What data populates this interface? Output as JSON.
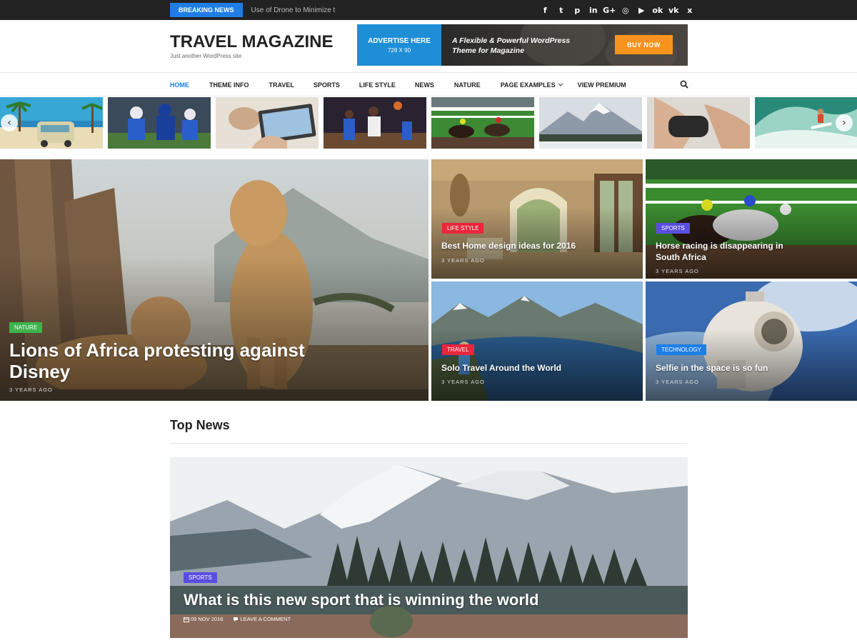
{
  "topbar": {
    "breaking_label": "BREAKING NEWS",
    "breaking_text": "Use of Drone to Minimize the",
    "socials": [
      {
        "icon": "facebook-icon",
        "glyph": "f"
      },
      {
        "icon": "twitter-icon",
        "glyph": "t"
      },
      {
        "icon": "pinterest-icon",
        "glyph": "p"
      },
      {
        "icon": "linkedin-icon",
        "glyph": "in"
      },
      {
        "icon": "google-plus-icon",
        "glyph": "G+"
      },
      {
        "icon": "instagram-icon",
        "glyph": "◎"
      },
      {
        "icon": "youtube-icon",
        "glyph": "▶"
      },
      {
        "icon": "odnoklassniki-icon",
        "glyph": "ok"
      },
      {
        "icon": "vk-icon",
        "glyph": "vk"
      },
      {
        "icon": "xing-icon",
        "glyph": "x"
      }
    ]
  },
  "header": {
    "site_title": "TRAVEL MAGAZINE",
    "tagline": "Just another WordPress site",
    "ad": {
      "left_line1": "ADVERTISE HERE",
      "left_line2": "728 X 90",
      "tag_line1": "A Flexible & Powerful WordPress",
      "tag_line2": "Theme for Magazine",
      "buy_label": "BUY NOW"
    }
  },
  "nav": {
    "items": [
      {
        "label": "HOME",
        "active": true
      },
      {
        "label": "THEME INFO"
      },
      {
        "label": "TRAVEL"
      },
      {
        "label": "SPORTS"
      },
      {
        "label": "LIFE STYLE"
      },
      {
        "label": "NEWS"
      },
      {
        "label": "NATURE"
      },
      {
        "label": "PAGE EXAMPLES"
      },
      {
        "label": "VIEW PREMIUM"
      }
    ],
    "dropdown_icon": "chevron-down-icon",
    "search_icon": "search-icon"
  },
  "featured": {
    "main": {
      "category": "NATURE",
      "title_line1": "Lions of Africa protesting against",
      "title_line2": "Disney",
      "ago": "3 YEARS AGO"
    },
    "tiles": [
      {
        "category": "LIFE STYLE",
        "title": "Best Home design ideas for 2016",
        "ago": "3 YEARS AGO"
      },
      {
        "category": "SPORTS",
        "title_line1": "Horse racing is disappearing in",
        "title_line2": "South Africa",
        "ago": "3 YEARS AGO"
      },
      {
        "category": "TRAVEL",
        "title": "Solo Travel Around the World",
        "ago": "3 YEARS AGO"
      },
      {
        "category": "TECHNOLOGY",
        "title": "Selfie in the space is so fun",
        "ago": "3 YEARS AGO"
      }
    ]
  },
  "top_news": {
    "section_title": "Top News",
    "post": {
      "category": "SPORTS",
      "title": "What is this new sport that is winning the world",
      "date": "09 NOV 2016",
      "comments": "LEAVE A COMMENT"
    }
  },
  "colors": {
    "accent_blue": "#1e7ee6",
    "life_style": "#e8273b",
    "sports": "#5a4ee0",
    "travel": "#e8273b",
    "technology": "#1e7ee6",
    "nature": "#3cb44b",
    "buy_now": "#f7941d"
  }
}
